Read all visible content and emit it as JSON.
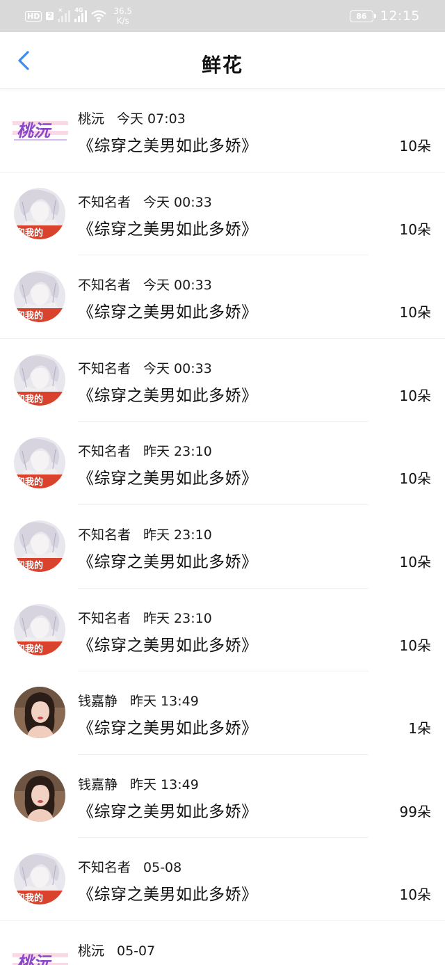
{
  "status_bar": {
    "hd": "HD",
    "sim": "2",
    "network": "4G",
    "speed_value": "36.5",
    "speed_unit": "K/s",
    "battery": "86",
    "time": "12:15"
  },
  "header": {
    "title": "鲜花",
    "back_icon": "chevron-left-icon",
    "accent_color": "#3d8bf5"
  },
  "records": [
    {
      "avatar": "logo",
      "avatar_text": "桃沅",
      "sender": "桃沅",
      "time": "今天 07:03",
      "book": "《综穿之美男如此多娇》",
      "amount": "10朵"
    },
    {
      "avatar": "anime",
      "avatar_text": "和我的",
      "sender": "不知名者",
      "time": "今天 00:33",
      "book": "《综穿之美男如此多娇》",
      "amount": "10朵"
    },
    {
      "avatar": "anime",
      "avatar_text": "和我的",
      "sender": "不知名者",
      "time": "今天 00:33",
      "book": "《综穿之美男如此多娇》",
      "amount": "10朵"
    },
    {
      "avatar": "anime",
      "avatar_text": "和我的",
      "sender": "不知名者",
      "time": "今天 00:33",
      "book": "《综穿之美男如此多娇》",
      "amount": "10朵"
    },
    {
      "avatar": "anime",
      "avatar_text": "和我的",
      "sender": "不知名者",
      "time": "昨天 23:10",
      "book": "《综穿之美男如此多娇》",
      "amount": "10朵"
    },
    {
      "avatar": "anime",
      "avatar_text": "和我的",
      "sender": "不知名者",
      "time": "昨天 23:10",
      "book": "《综穿之美男如此多娇》",
      "amount": "10朵"
    },
    {
      "avatar": "anime",
      "avatar_text": "和我的",
      "sender": "不知名者",
      "time": "昨天 23:10",
      "book": "《综穿之美男如此多娇》",
      "amount": "10朵"
    },
    {
      "avatar": "photo",
      "sender": "钱嘉静",
      "time": "昨天 13:49",
      "book": "《综穿之美男如此多娇》",
      "amount": "1朵"
    },
    {
      "avatar": "photo",
      "sender": "钱嘉静",
      "time": "昨天 13:49",
      "book": "《综穿之美男如此多娇》",
      "amount": "99朵"
    },
    {
      "avatar": "anime",
      "avatar_text": "和我的",
      "sender": "不知名者",
      "time": "05-08",
      "book": "《综穿之美男如此多娇》",
      "amount": "10朵"
    },
    {
      "avatar": "logo",
      "avatar_text": "桃沅",
      "sender": "桃沅",
      "time": "05-07",
      "book": "",
      "amount": ""
    }
  ]
}
